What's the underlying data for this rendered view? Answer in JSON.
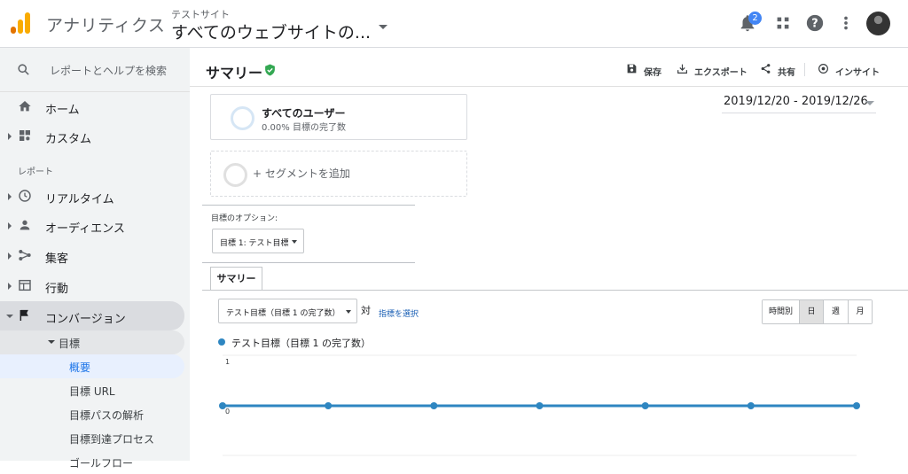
{
  "app": {
    "title": "アナリティクス",
    "account_small": "テストサイト",
    "account_main": "すべてのウェブサイトの...",
    "notification_count": "2"
  },
  "sidebar": {
    "search_placeholder": "レポートとヘルプを検索",
    "items": [
      {
        "label": "ホーム"
      },
      {
        "label": "カスタム"
      }
    ],
    "section_label": "レポート",
    "report_items": [
      {
        "label": "リアルタイム"
      },
      {
        "label": "オーディエンス"
      },
      {
        "label": "集客"
      },
      {
        "label": "行動"
      },
      {
        "label": "コンバージョン"
      }
    ],
    "goal_group": "目標",
    "goal_sub": [
      {
        "label": "概要"
      },
      {
        "label": "目標 URL"
      },
      {
        "label": "目標パスの解析"
      },
      {
        "label": "目標到達プロセス"
      },
      {
        "label": "ゴールフロー"
      }
    ]
  },
  "header": {
    "page_title": "サマリー",
    "actions": {
      "save": "保存",
      "export": "エクスポート",
      "share": "共有",
      "insight": "インサイト"
    }
  },
  "segments": {
    "all_users_title": "すべてのユーザー",
    "all_users_sub": "0.00% 目標の完了数",
    "add_segment": "+ セグメントを追加"
  },
  "date_range": "2019/12/20 - 2019/12/26",
  "goal_options": {
    "label": "目標のオプション:",
    "selected": "目標 1: テスト目標"
  },
  "tabs": [
    {
      "label": "サマリー"
    }
  ],
  "metric": {
    "selected": "テスト目標（目標 1 の完了数）",
    "vs": "対",
    "pick_metric": "指標を選択"
  },
  "granularity": [
    {
      "label": "時間別",
      "active": false
    },
    {
      "label": "日",
      "active": true
    },
    {
      "label": "週",
      "active": false
    },
    {
      "label": "月",
      "active": false
    }
  ],
  "chart_data": {
    "type": "line",
    "series": [
      {
        "name": "テスト目標（目標 1 の完了数）",
        "color": "#2e86c1",
        "values": [
          0,
          0,
          0,
          0,
          0,
          0,
          0
        ]
      }
    ],
    "ylim": [
      0,
      1
    ],
    "yticks": [
      "1",
      "0"
    ],
    "grid": true
  },
  "colors": {
    "accent": "#1a73e8",
    "series": "#2e86c1",
    "verified": "#34a853",
    "logo_orange": "#f9ab00",
    "logo_dark": "#e37400"
  }
}
